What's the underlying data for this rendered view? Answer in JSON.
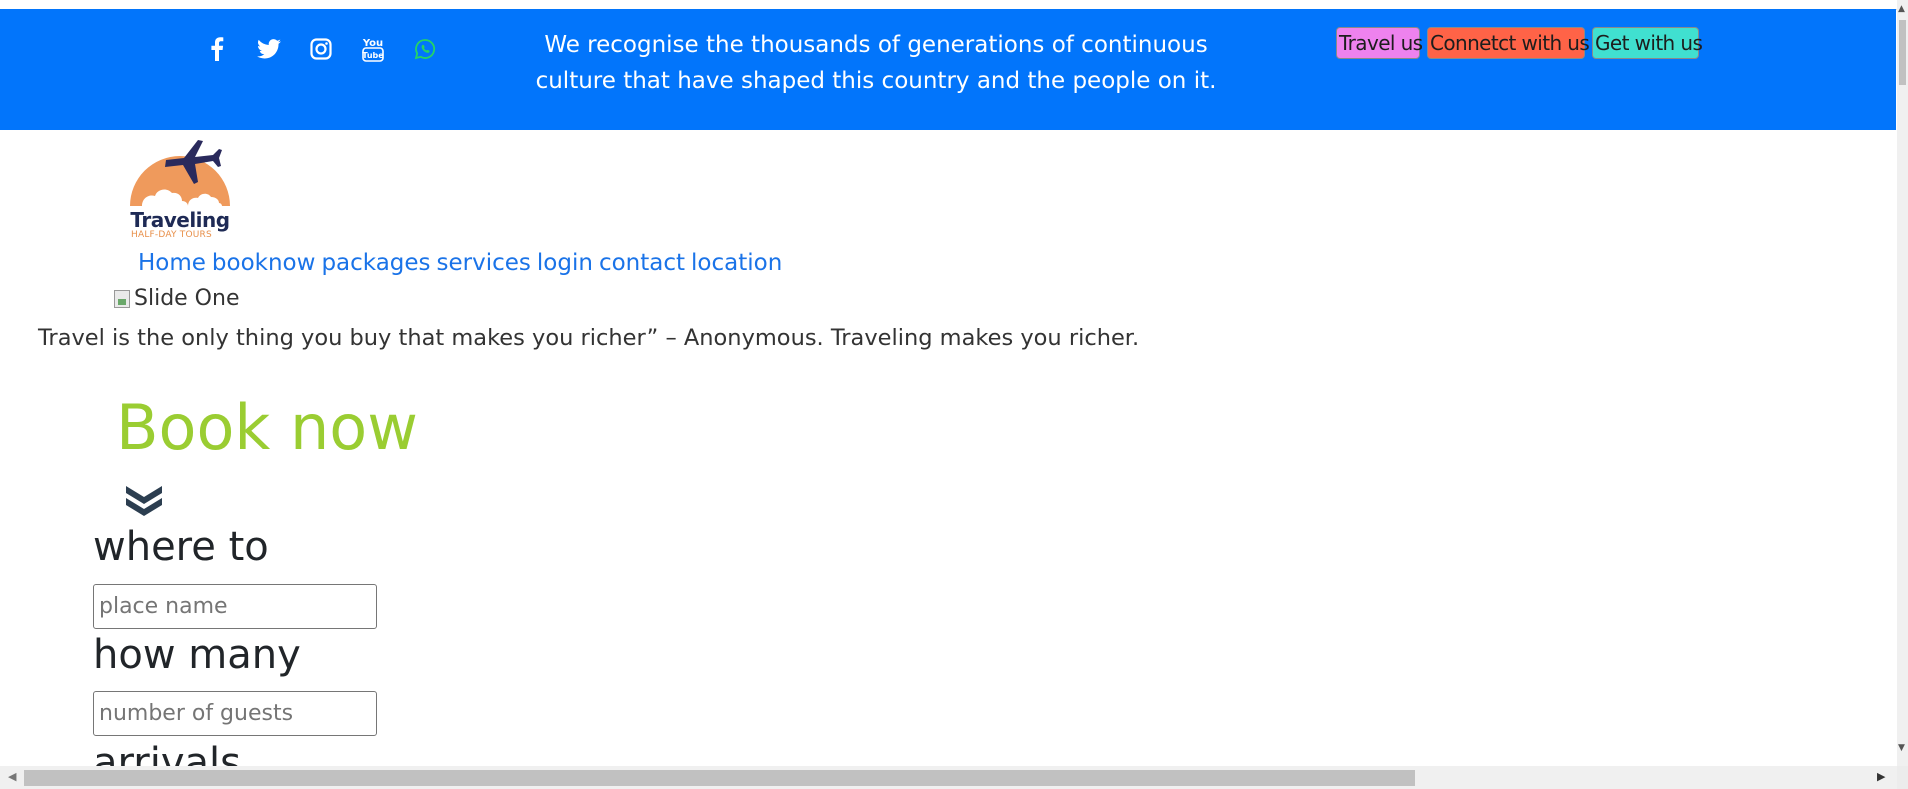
{
  "topbar": {
    "acknowledgement": "We recognise the thousands of generations of continuous culture that have shaped this country and the people on it.",
    "social_icons": [
      "facebook-icon",
      "twitter-icon",
      "instagram-icon",
      "youtube-icon",
      "whatsapp-icon"
    ],
    "buttons": [
      {
        "label": "Travel us",
        "color": "#ee82ee"
      },
      {
        "label": "Connetct with us",
        "color": "#ff6347"
      },
      {
        "label": "Get with us",
        "color": "#40e0d0"
      }
    ],
    "background": "#0275fb"
  },
  "logo": {
    "title": "Traveling",
    "subtitle": "HALF-DAY TOURS"
  },
  "nav": [
    "Home",
    "booknow",
    "packages",
    "services",
    "login",
    "contact",
    "location"
  ],
  "slide": {
    "alt": "Slide One"
  },
  "quote": "Travel is the only thing you buy that makes you richer” – Anonymous. Traveling makes you richer.",
  "booking": {
    "heading": "Book now",
    "heading_color": "#9acd32",
    "where_label": "where to",
    "where_placeholder": "place name",
    "how_many_label": "how many",
    "how_many_placeholder": "number of guests",
    "arrivals_label": "arrivals"
  }
}
